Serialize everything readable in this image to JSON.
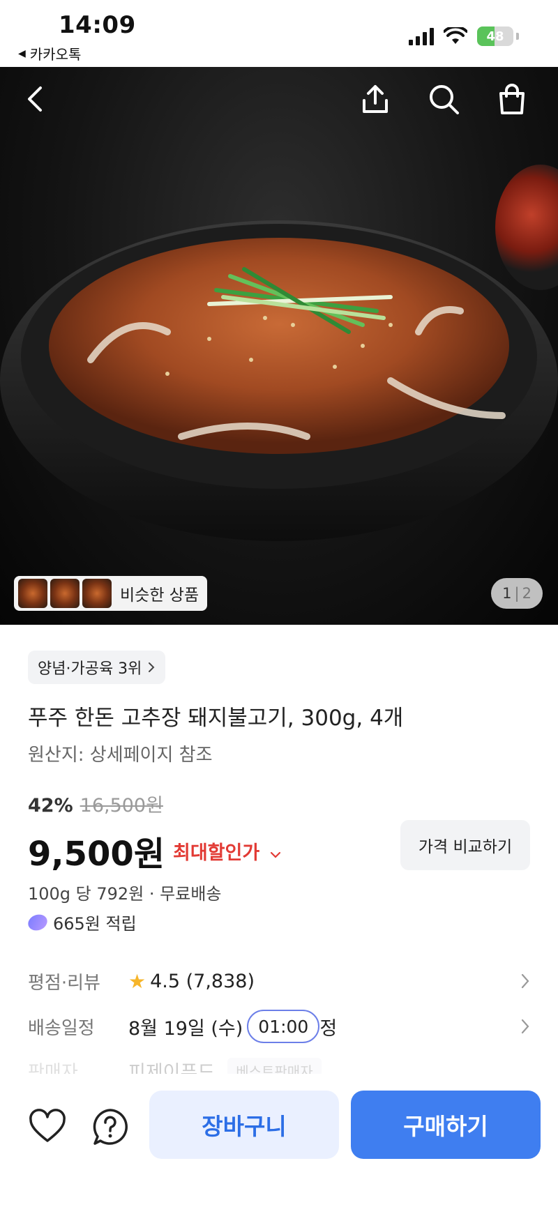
{
  "status": {
    "time": "14:09",
    "back_app": "카카오톡",
    "battery": "48",
    "battery_level": 0.48
  },
  "hero": {
    "similar_label": "비슷한 상품",
    "page_current": "1",
    "page_total": "2"
  },
  "product": {
    "rank": "양념·가공육 3위",
    "title": "푸주 한돈 고추장 돼지불고기, 300g, 4개",
    "origin": "원산지: 상세페이지 참조",
    "discount_pct": "42%",
    "original_price": "16,500원",
    "price": "9,500원",
    "best_price_label": "최대할인가",
    "compare_label": "가격 비교하기",
    "unit_price": "100g 당 792원 · 무료배송",
    "points": "665원 적립"
  },
  "info_rows": {
    "rating_label": "평점·리뷰",
    "rating_value": "4.5 (7,838)",
    "delivery_label": "배송일정",
    "delivery_date": "8월 19일 (수)",
    "delivery_time": "01:00",
    "delivery_suffix": "정",
    "seller_label": "판매자",
    "seller_value": "피제이푸드",
    "seller_badge": "베스트판매자"
  },
  "actions": {
    "cart_label": "장바구니",
    "buy_label": "구매하기"
  },
  "colors": {
    "accent": "#3f7ef0",
    "sale_red": "#e23a34",
    "battery_green": "#5ac35a"
  }
}
